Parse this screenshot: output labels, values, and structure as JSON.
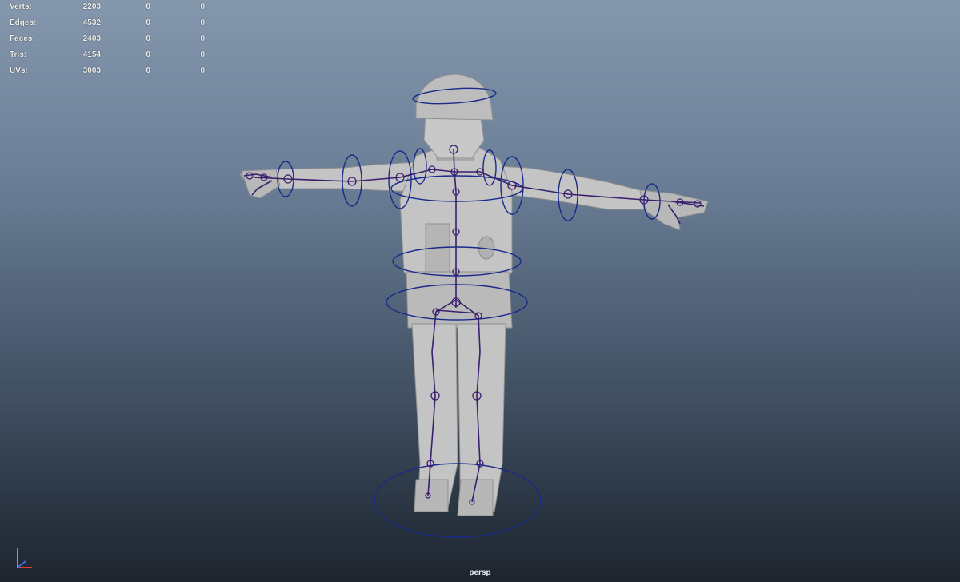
{
  "hud": {
    "rows": [
      {
        "label": "Verts:",
        "value": "2203",
        "sel": "0",
        "sel2": "0"
      },
      {
        "label": "Edges:",
        "value": "4532",
        "sel": "0",
        "sel2": "0"
      },
      {
        "label": "Faces:",
        "value": "2403",
        "sel": "0",
        "sel2": "0"
      },
      {
        "label": "Tris:",
        "value": "4154",
        "sel": "0",
        "sel2": "0"
      },
      {
        "label": "UVs:",
        "value": "3003",
        "sel": "0",
        "sel2": "0"
      }
    ]
  },
  "viewport": {
    "camera_label": "persp",
    "model": "rigged-soldier-t-pose",
    "rig_color": "#3a1f6e",
    "control_color": "#1a2a8a",
    "mesh_color": "#c4c4c4"
  },
  "axis": {
    "x": "X",
    "y": "Y",
    "z": "Z"
  }
}
